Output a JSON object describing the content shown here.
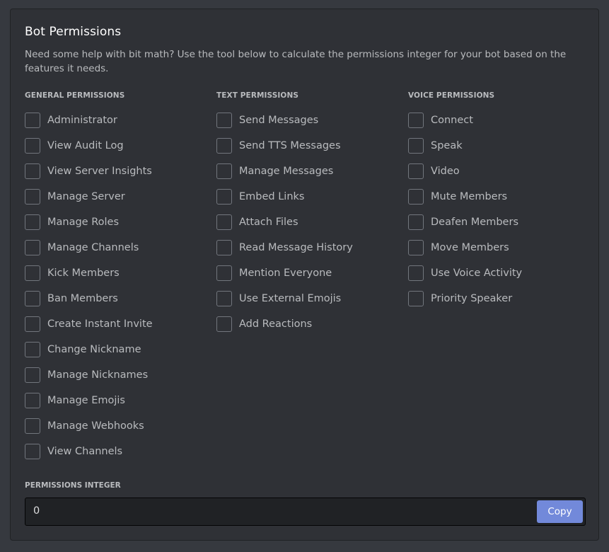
{
  "title": "Bot Permissions",
  "description": "Need some help with bit math? Use the tool below to calculate the permissions integer for your bot based on the features it needs.",
  "columns": {
    "general": {
      "header": "GENERAL PERMISSIONS",
      "items": [
        {
          "label": "Administrator",
          "checked": false
        },
        {
          "label": "View Audit Log",
          "checked": false
        },
        {
          "label": "View Server Insights",
          "checked": false
        },
        {
          "label": "Manage Server",
          "checked": false
        },
        {
          "label": "Manage Roles",
          "checked": false
        },
        {
          "label": "Manage Channels",
          "checked": false
        },
        {
          "label": "Kick Members",
          "checked": false
        },
        {
          "label": "Ban Members",
          "checked": false
        },
        {
          "label": "Create Instant Invite",
          "checked": false
        },
        {
          "label": "Change Nickname",
          "checked": false
        },
        {
          "label": "Manage Nicknames",
          "checked": false
        },
        {
          "label": "Manage Emojis",
          "checked": false
        },
        {
          "label": "Manage Webhooks",
          "checked": false
        },
        {
          "label": "View Channels",
          "checked": false
        }
      ]
    },
    "text": {
      "header": "TEXT PERMISSIONS",
      "items": [
        {
          "label": "Send Messages",
          "checked": false
        },
        {
          "label": "Send TTS Messages",
          "checked": false
        },
        {
          "label": "Manage Messages",
          "checked": false
        },
        {
          "label": "Embed Links",
          "checked": false
        },
        {
          "label": "Attach Files",
          "checked": false
        },
        {
          "label": "Read Message History",
          "checked": false
        },
        {
          "label": "Mention Everyone",
          "checked": false
        },
        {
          "label": "Use External Emojis",
          "checked": false
        },
        {
          "label": "Add Reactions",
          "checked": false
        }
      ]
    },
    "voice": {
      "header": "VOICE PERMISSIONS",
      "items": [
        {
          "label": "Connect",
          "checked": false
        },
        {
          "label": "Speak",
          "checked": false
        },
        {
          "label": "Video",
          "checked": false
        },
        {
          "label": "Mute Members",
          "checked": false
        },
        {
          "label": "Deafen Members",
          "checked": false
        },
        {
          "label": "Move Members",
          "checked": false
        },
        {
          "label": "Use Voice Activity",
          "checked": false
        },
        {
          "label": "Priority Speaker",
          "checked": false
        }
      ]
    }
  },
  "permissions_integer": {
    "label": "PERMISSIONS INTEGER",
    "value": "0",
    "copy_label": "Copy"
  },
  "colors": {
    "background": "#36393f",
    "panel": "#2f3136",
    "accent": "#7289da",
    "text": "#b9bbbe"
  }
}
